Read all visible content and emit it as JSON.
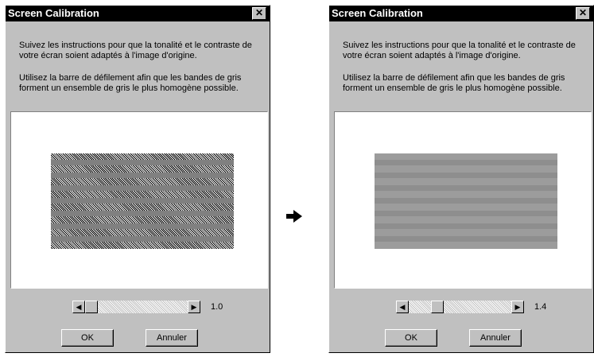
{
  "dialogs": [
    {
      "title": "Screen Calibration",
      "close_glyph": "✕",
      "instructions": [
        "Suivez les instructions pour que la tonalité et le contraste de votre écran soient adaptés à l'image d'origine.",
        "Utilisez la barre de défilement afin que les bandes de gris forment un ensemble de gris le plus homogène possible."
      ],
      "slider": {
        "value": "1.0",
        "level": 0.0,
        "left_glyph": "◀",
        "right_glyph": "▶"
      },
      "ok_label": "OK",
      "cancel_label": "Annuler"
    },
    {
      "title": "Screen Calibration",
      "close_glyph": "✕",
      "instructions": [
        "Suivez les instructions pour que la tonalité et le contraste de votre écran soient adaptés à l'image d'origine.",
        "Utilisez la barre de défilement afin que les bandes de gris forment un ensemble de gris le plus homogène possible."
      ],
      "slider": {
        "value": "1.4",
        "level": 0.25,
        "left_glyph": "◀",
        "right_glyph": "▶"
      },
      "ok_label": "OK",
      "cancel_label": "Annuler"
    }
  ],
  "step_arrow_icon": "right-arrow-icon",
  "colors": {
    "dialog_bg": "#c0c0c0",
    "titlebar": "#000000",
    "title_text": "#ffffff"
  }
}
